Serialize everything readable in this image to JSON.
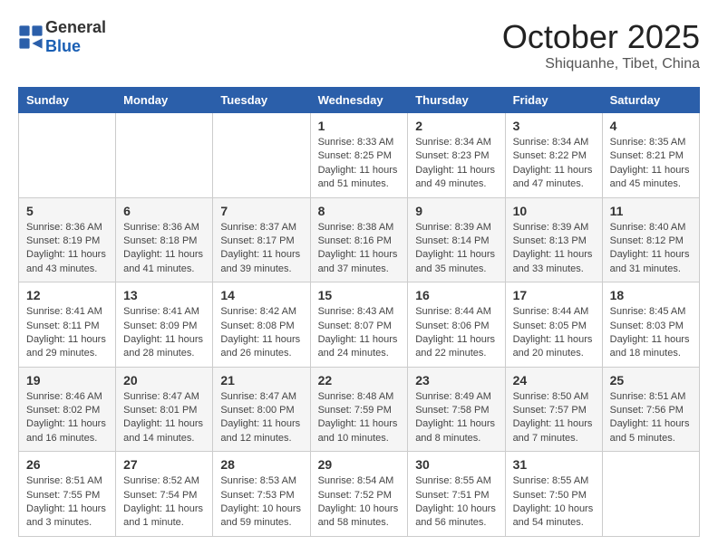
{
  "header": {
    "logo_general": "General",
    "logo_blue": "Blue",
    "month": "October 2025",
    "location": "Shiquanhe, Tibet, China"
  },
  "weekdays": [
    "Sunday",
    "Monday",
    "Tuesday",
    "Wednesday",
    "Thursday",
    "Friday",
    "Saturday"
  ],
  "weeks": [
    [
      {
        "day": "",
        "info": ""
      },
      {
        "day": "",
        "info": ""
      },
      {
        "day": "",
        "info": ""
      },
      {
        "day": "1",
        "info": "Sunrise: 8:33 AM\nSunset: 8:25 PM\nDaylight: 11 hours\nand 51 minutes."
      },
      {
        "day": "2",
        "info": "Sunrise: 8:34 AM\nSunset: 8:23 PM\nDaylight: 11 hours\nand 49 minutes."
      },
      {
        "day": "3",
        "info": "Sunrise: 8:34 AM\nSunset: 8:22 PM\nDaylight: 11 hours\nand 47 minutes."
      },
      {
        "day": "4",
        "info": "Sunrise: 8:35 AM\nSunset: 8:21 PM\nDaylight: 11 hours\nand 45 minutes."
      }
    ],
    [
      {
        "day": "5",
        "info": "Sunrise: 8:36 AM\nSunset: 8:19 PM\nDaylight: 11 hours\nand 43 minutes."
      },
      {
        "day": "6",
        "info": "Sunrise: 8:36 AM\nSunset: 8:18 PM\nDaylight: 11 hours\nand 41 minutes."
      },
      {
        "day": "7",
        "info": "Sunrise: 8:37 AM\nSunset: 8:17 PM\nDaylight: 11 hours\nand 39 minutes."
      },
      {
        "day": "8",
        "info": "Sunrise: 8:38 AM\nSunset: 8:16 PM\nDaylight: 11 hours\nand 37 minutes."
      },
      {
        "day": "9",
        "info": "Sunrise: 8:39 AM\nSunset: 8:14 PM\nDaylight: 11 hours\nand 35 minutes."
      },
      {
        "day": "10",
        "info": "Sunrise: 8:39 AM\nSunset: 8:13 PM\nDaylight: 11 hours\nand 33 minutes."
      },
      {
        "day": "11",
        "info": "Sunrise: 8:40 AM\nSunset: 8:12 PM\nDaylight: 11 hours\nand 31 minutes."
      }
    ],
    [
      {
        "day": "12",
        "info": "Sunrise: 8:41 AM\nSunset: 8:11 PM\nDaylight: 11 hours\nand 29 minutes."
      },
      {
        "day": "13",
        "info": "Sunrise: 8:41 AM\nSunset: 8:09 PM\nDaylight: 11 hours\nand 28 minutes."
      },
      {
        "day": "14",
        "info": "Sunrise: 8:42 AM\nSunset: 8:08 PM\nDaylight: 11 hours\nand 26 minutes."
      },
      {
        "day": "15",
        "info": "Sunrise: 8:43 AM\nSunset: 8:07 PM\nDaylight: 11 hours\nand 24 minutes."
      },
      {
        "day": "16",
        "info": "Sunrise: 8:44 AM\nSunset: 8:06 PM\nDaylight: 11 hours\nand 22 minutes."
      },
      {
        "day": "17",
        "info": "Sunrise: 8:44 AM\nSunset: 8:05 PM\nDaylight: 11 hours\nand 20 minutes."
      },
      {
        "day": "18",
        "info": "Sunrise: 8:45 AM\nSunset: 8:03 PM\nDaylight: 11 hours\nand 18 minutes."
      }
    ],
    [
      {
        "day": "19",
        "info": "Sunrise: 8:46 AM\nSunset: 8:02 PM\nDaylight: 11 hours\nand 16 minutes."
      },
      {
        "day": "20",
        "info": "Sunrise: 8:47 AM\nSunset: 8:01 PM\nDaylight: 11 hours\nand 14 minutes."
      },
      {
        "day": "21",
        "info": "Sunrise: 8:47 AM\nSunset: 8:00 PM\nDaylight: 11 hours\nand 12 minutes."
      },
      {
        "day": "22",
        "info": "Sunrise: 8:48 AM\nSunset: 7:59 PM\nDaylight: 11 hours\nand 10 minutes."
      },
      {
        "day": "23",
        "info": "Sunrise: 8:49 AM\nSunset: 7:58 PM\nDaylight: 11 hours\nand 8 minutes."
      },
      {
        "day": "24",
        "info": "Sunrise: 8:50 AM\nSunset: 7:57 PM\nDaylight: 11 hours\nand 7 minutes."
      },
      {
        "day": "25",
        "info": "Sunrise: 8:51 AM\nSunset: 7:56 PM\nDaylight: 11 hours\nand 5 minutes."
      }
    ],
    [
      {
        "day": "26",
        "info": "Sunrise: 8:51 AM\nSunset: 7:55 PM\nDaylight: 11 hours\nand 3 minutes."
      },
      {
        "day": "27",
        "info": "Sunrise: 8:52 AM\nSunset: 7:54 PM\nDaylight: 11 hours\nand 1 minute."
      },
      {
        "day": "28",
        "info": "Sunrise: 8:53 AM\nSunset: 7:53 PM\nDaylight: 10 hours\nand 59 minutes."
      },
      {
        "day": "29",
        "info": "Sunrise: 8:54 AM\nSunset: 7:52 PM\nDaylight: 10 hours\nand 58 minutes."
      },
      {
        "day": "30",
        "info": "Sunrise: 8:55 AM\nSunset: 7:51 PM\nDaylight: 10 hours\nand 56 minutes."
      },
      {
        "day": "31",
        "info": "Sunrise: 8:55 AM\nSunset: 7:50 PM\nDaylight: 10 hours\nand 54 minutes."
      },
      {
        "day": "",
        "info": ""
      }
    ]
  ]
}
